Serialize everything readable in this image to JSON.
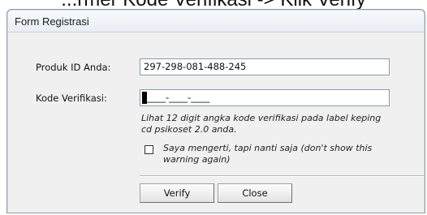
{
  "caption": "...rmer Kode Verifikasi -> Klik Verify",
  "window": {
    "title": "Form Registrasi"
  },
  "form": {
    "produk_label": "Produk ID Anda:",
    "produk_value": "297-298-081-488-245",
    "kode_label": "Kode Verifikasi:",
    "kode_value": "____-____-____",
    "hint": "Lihat 12 digit angka kode verifikasi pada label keping cd psikoset 2.0 anda.",
    "checkbox_label": "Saya mengerti, tapi nanti saja (don't show this warning again)",
    "checkbox_checked": false
  },
  "buttons": {
    "verify_label": "Verify",
    "close_label": "Close"
  }
}
